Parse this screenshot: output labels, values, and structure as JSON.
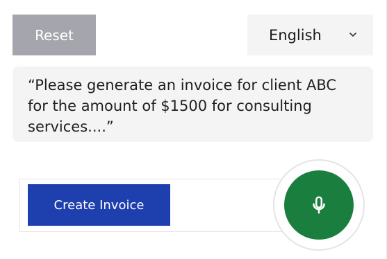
{
  "toolbar": {
    "reset_label": "Reset"
  },
  "language": {
    "selected": "English",
    "icon": "chevron-down-icon"
  },
  "prompt": {
    "text": "“Please generate an invoice for client ABC for the amount of $1500 for consulting services....”"
  },
  "actions": {
    "create_invoice_label": "Create Invoice",
    "mic_icon": "microphone-icon"
  },
  "colors": {
    "reset_bg": "#a5a6ad",
    "create_bg": "#1e3fae",
    "mic_bg": "#1a7f3e",
    "panel_bg": "#f4f4f5"
  }
}
